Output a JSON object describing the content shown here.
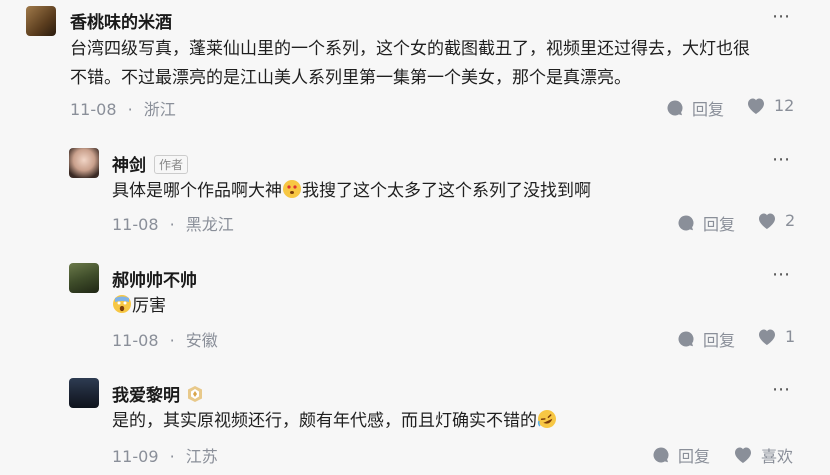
{
  "comments": [
    {
      "name": "香桃味的米酒",
      "text": "台湾四级写真，蓬莱仙山里的一个系列，这个女的截图截丑了，视频里还过得去，大灯也很不错。不过最漂亮的是江山美人系列里第一集第一个美女，那个是真漂亮。",
      "date": "11-08",
      "location": "浙江",
      "reply_label": "回复",
      "like_count": "12"
    },
    {
      "name": "神剑",
      "author_tag": "作者",
      "text_before": "具体是哪个作品啊大神",
      "text_after": "我搜了这个太多了这个系列了没找到啊",
      "date": "11-08",
      "location": "黑龙江",
      "reply_label": "回复",
      "like_count": "2"
    },
    {
      "name": "郝帅帅不帅",
      "text": "厉害",
      "date": "11-08",
      "location": "安徽",
      "reply_label": "回复",
      "like_count": "1"
    },
    {
      "name": "我爱黎明",
      "text": "是的，其实原视频还行，颇有年代感，而且灯确实不错的",
      "date": "11-09",
      "location": "江苏",
      "reply_label": "回复",
      "like_label": "喜欢"
    }
  ],
  "separator": "·",
  "more_glyph": "⋯",
  "colors": {
    "meta": "#8a8f99",
    "icon": "#8a8f99",
    "text": "#1f1f1f"
  }
}
